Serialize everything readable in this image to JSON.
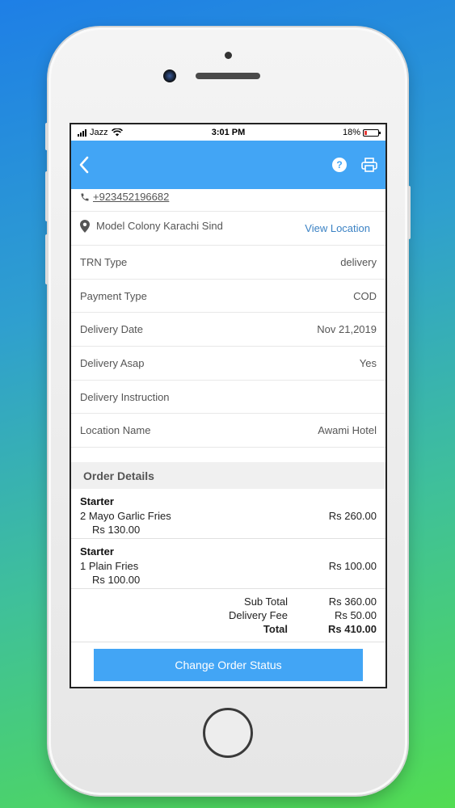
{
  "status_bar": {
    "carrier": "Jazz",
    "time": "3:01 PM",
    "battery": "18%",
    "battery_level": 0.18
  },
  "app_bar": {
    "back_icon": "chevron-left-icon",
    "help_icon": "help-circle-icon",
    "help_glyph": "?",
    "print_icon": "printer-icon",
    "color": "#42a5f5"
  },
  "contact": {
    "phone": "+923452196682",
    "address": "Model Colony Karachi Sind",
    "view_location": "View Location"
  },
  "details": [
    {
      "label": "TRN Type",
      "value": "delivery"
    },
    {
      "label": "Payment Type",
      "value": "COD"
    },
    {
      "label": "Delivery Date",
      "value": "Nov 21,2019"
    },
    {
      "label": "Delivery Asap",
      "value": "Yes"
    },
    {
      "label": "Delivery Instruction",
      "value": ""
    },
    {
      "label": "Location Name",
      "value": "Awami Hotel"
    }
  ],
  "order": {
    "header": "Order Details",
    "items": [
      {
        "category": "Starter",
        "qty_name": "2  Mayo Garlic Fries",
        "price": "Rs 260.00",
        "unit_price": "Rs 130.00"
      },
      {
        "category": "Starter",
        "qty_name": "1  Plain Fries",
        "price": "Rs 100.00",
        "unit_price": "Rs 100.00"
      }
    ],
    "totals": {
      "sub_total_label": "Sub Total",
      "sub_total": "Rs 360.00",
      "delivery_fee_label": "Delivery Fee",
      "delivery_fee": "Rs 50.00",
      "total_label": "Total",
      "total": "Rs 410.00"
    }
  },
  "cta": {
    "label": "Change Order Status"
  }
}
